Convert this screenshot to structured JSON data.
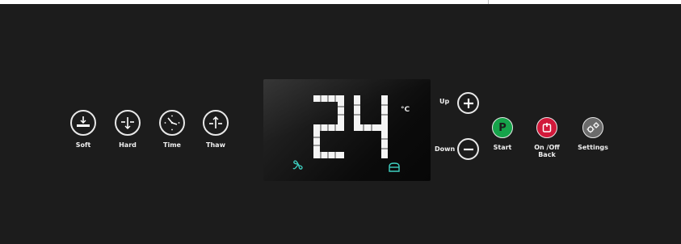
{
  "controls": {
    "soft_label": "Soft",
    "hard_label": "Hard",
    "time_label": "Time",
    "thaw_label": "Thaw"
  },
  "display": {
    "temperature": "24",
    "unit": "°C",
    "fan_icon": "fan-icon",
    "lock_icon": "compartment-icon"
  },
  "adjust": {
    "up_label": "Up",
    "down_label": "Down"
  },
  "actions": {
    "start_label": "Start",
    "onoff_label": "On /Off\nBack",
    "settings_label": "Settings"
  },
  "colors": {
    "background": "#1c1c1c",
    "start_green": "#16a34a",
    "power_red": "#d1193a",
    "display_teal": "#3ecfc0"
  }
}
